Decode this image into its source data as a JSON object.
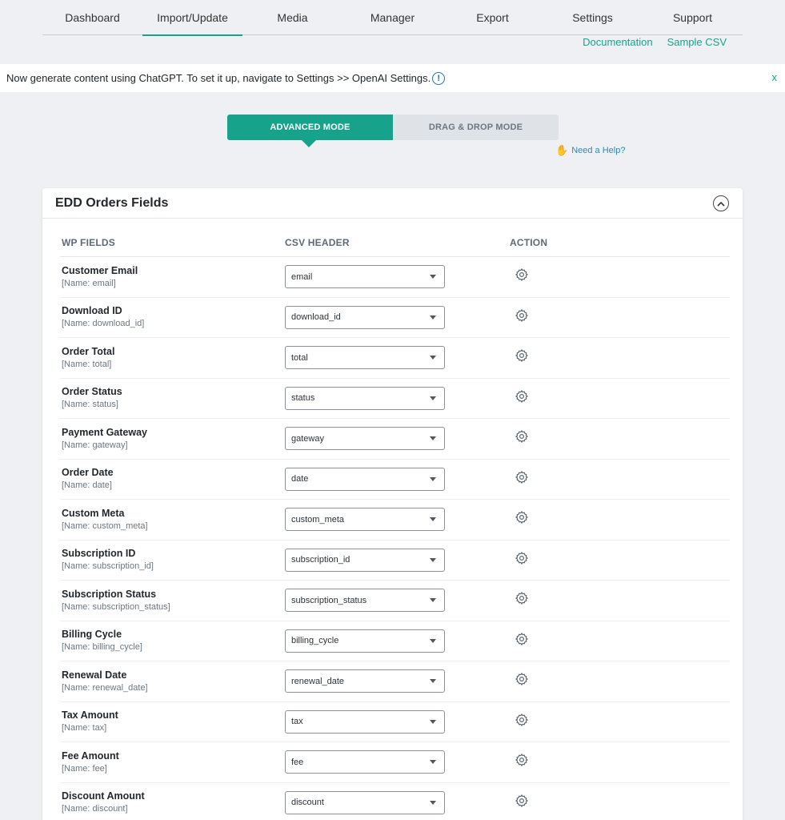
{
  "nav": {
    "tabs": [
      {
        "label": "Dashboard"
      },
      {
        "label": "Import/Update"
      },
      {
        "label": "Media"
      },
      {
        "label": "Manager"
      },
      {
        "label": "Export"
      },
      {
        "label": "Settings"
      },
      {
        "label": "Support"
      }
    ],
    "active": "Import/Update",
    "links": {
      "documentation": "Documentation",
      "sample_csv": "Sample CSV"
    }
  },
  "notice": {
    "text": "Now generate content using ChatGPT. To set it up, navigate to Settings >> OpenAI Settings.",
    "info_glyph": "!",
    "dismiss": "x"
  },
  "modes": {
    "advanced": "ADVANCED MODE",
    "drag_drop": "DRAG & DROP MODE",
    "active": "advanced"
  },
  "help": {
    "label": "Need a Help?",
    "icon": "hand-icon"
  },
  "panel": {
    "title": "EDD Orders Fields",
    "columns": {
      "wp_fields": "WP FIELDS",
      "csv_header": "CSV HEADER",
      "action": "ACTION"
    },
    "rows": [
      {
        "label": "Customer Email",
        "name": "[Name: email]",
        "csv": "email"
      },
      {
        "label": "Download ID",
        "name": "[Name: download_id]",
        "csv": "download_id"
      },
      {
        "label": "Order Total",
        "name": "[Name: total]",
        "csv": "total"
      },
      {
        "label": "Order Status",
        "name": "[Name: status]",
        "csv": "status"
      },
      {
        "label": "Payment Gateway",
        "name": "[Name: gateway]",
        "csv": "gateway"
      },
      {
        "label": "Order Date",
        "name": "[Name: date]",
        "csv": "date"
      },
      {
        "label": "Custom Meta",
        "name": "[Name: custom_meta]",
        "csv": "custom_meta"
      },
      {
        "label": "Subscription ID",
        "name": "[Name: subscription_id]",
        "csv": "subscription_id"
      },
      {
        "label": "Subscription Status",
        "name": "[Name: subscription_status]",
        "csv": "subscription_status"
      },
      {
        "label": "Billing Cycle",
        "name": "[Name: billing_cycle]",
        "csv": "billing_cycle"
      },
      {
        "label": "Renewal Date",
        "name": "[Name: renewal_date]",
        "csv": "renewal_date"
      },
      {
        "label": "Tax Amount",
        "name": "[Name: tax]",
        "csv": "tax"
      },
      {
        "label": "Fee Amount",
        "name": "[Name: fee]",
        "csv": "fee"
      },
      {
        "label": "Discount Amount",
        "name": "[Name: discount]",
        "csv": "discount"
      }
    ]
  },
  "colors": {
    "accent": "#17a38b",
    "link_blue": "#2a8ab4",
    "background": "#eef0f4"
  }
}
